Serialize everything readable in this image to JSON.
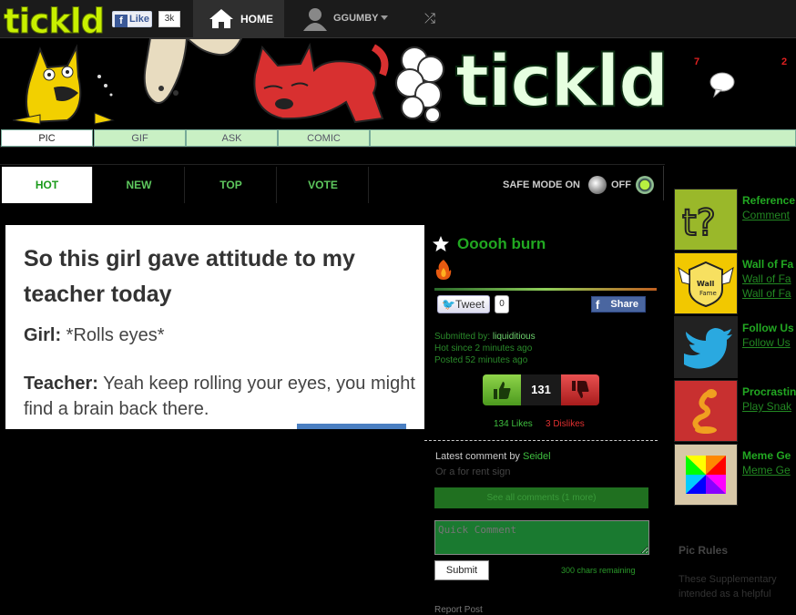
{
  "topbar": {
    "logo": "tickld",
    "fb_like": "Like",
    "fb_count": "3k",
    "home": "HOME",
    "user": "GGUMBY",
    "shuffle": "⤮"
  },
  "banner": {
    "word": "tickld",
    "notif_a": "7",
    "notif_b": "2"
  },
  "subtabs": [
    "PIC",
    "GIF",
    "ASK",
    "COMIC"
  ],
  "sorttabs": [
    "HOT",
    "NEW",
    "TOP",
    "VOTE"
  ],
  "safemode": {
    "label": "SAFE MODE ON",
    "off": "OFF"
  },
  "post": {
    "image_title": "So this girl gave attitude to my teacher today",
    "line1_speaker": "Girl:",
    "line1_text": " *Rolls eyes*",
    "line2_speaker": "Teacher:",
    "line2_text": " Yeah keep rolling your eyes, you might find a brain back there.",
    "title": "Ooooh burn",
    "tweet": "Tweet",
    "tweet_count": "0",
    "share": "Share",
    "submitted_label": "Submitted by: ",
    "submitted_user": "liquiditious",
    "hot_since": "Hot since 2 minutes ago",
    "posted": "Posted 52 minutes ago",
    "vote_count": "131",
    "likes": "134 Likes",
    "dislikes": "3 Dislikes",
    "latest_label": "Latest comment by ",
    "latest_user": "Seidel",
    "latest_text": "Or a for rent sign",
    "see_all": "See all comments (1 more)",
    "quick_placeholder": "Quick Comment",
    "submit": "Submit",
    "chars": "300 chars remaining",
    "report": "Report Post"
  },
  "sidebar": [
    {
      "title": "Reference",
      "sub1": "Comment",
      "icon": "question-icon",
      "color": "#9ab82a"
    },
    {
      "title": "Wall of Fa",
      "sub1": "Wall of Fa",
      "sub2": "Wall of Fa",
      "icon": "wall-of-fame-icon",
      "color": "#f2c800"
    },
    {
      "title": "Follow Us",
      "sub1": "Follow Us",
      "icon": "twitter-icon",
      "color": "#222"
    },
    {
      "title": "Procrastin",
      "sub1": "Play Snak",
      "icon": "snake-icon",
      "color": "#c83030"
    },
    {
      "title": "Meme Ge",
      "sub1": "Meme Ge",
      "icon": "color-wheel-icon",
      "color": "#d8c8a8"
    }
  ],
  "rules": {
    "heading": "Pic Rules",
    "line1": "These Supplementary",
    "line2": "intended as a helpful"
  }
}
